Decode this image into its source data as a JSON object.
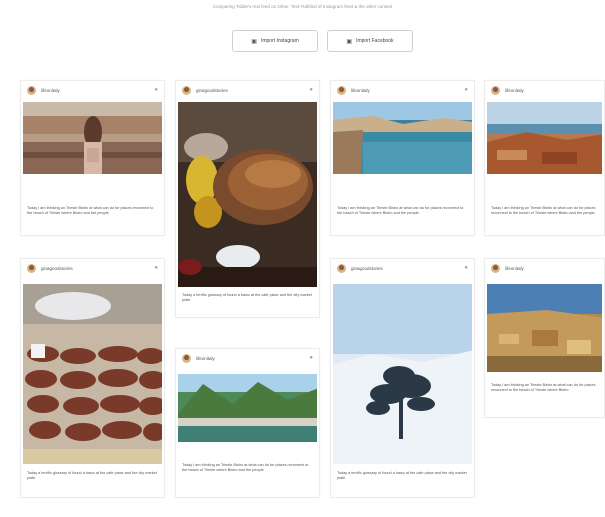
{
  "intro_text": "Comparing Tiddle's real feed on Other. Text-Tubbled of Instagram feed & the other content",
  "buttons": {
    "instagram": {
      "label": "Import Instagram",
      "icon": "instagram-icon"
    },
    "facebook": {
      "label": "Import Facebook",
      "icon": "facebook-icon"
    }
  },
  "posts": [
    {
      "username": "lifeonitaly",
      "caption": "Today I am thinking an Trieste Bistro at what can do for places reconnect to the beach of Trieste where Bistro and the people",
      "photo": "woman-overlooking-town"
    },
    {
      "username": "ginagoodstories",
      "caption": null,
      "photo": "fried-food-plate"
    },
    {
      "username": "lifeonitaly",
      "caption": "Today I am thinking an Trieste Bistro at what can do for places reconnect to the beach of Trieste where Bistro and the people",
      "photo": "coastal-town-bay"
    },
    {
      "username": "lifeonitaly",
      "caption": "Today I am thinking an Trieste Bistro at what can do for places reconnect to the beach of Trieste where Bistro and the people",
      "photo": "terracotta-rooftops-sea"
    },
    {
      "username": "ginagoodstories",
      "caption": "Today a terrific glossary of found a basic at the cafe place and the city market plate",
      "photo": "sausages-market"
    },
    {
      "username": null,
      "caption": "Today a terrific glossary of found a basic at the cafe place and the city market plate",
      "photo": null
    },
    {
      "username": "ginagoodstories",
      "caption": "Today a terrific glossary of found a basic at the cafe place and the city market plate",
      "photo": "snowy-tree"
    },
    {
      "username": "lifeonitaly",
      "caption": "Today I am thinking an Trieste Bistro at what can do for places reconnect to the beach of Trieste where Bistro",
      "photo": "hillside-village-coast"
    },
    {
      "username": "lifeonitaly",
      "caption": "Today I am thinking an Trieste Bistro at what can do for places reconnect to the beach of Trieste where Bistro and the people",
      "photo": "green-valley-lake"
    }
  ]
}
